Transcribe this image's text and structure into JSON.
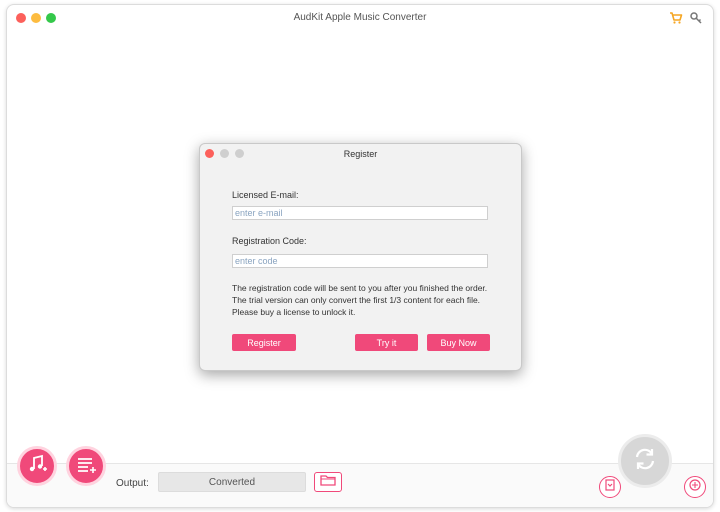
{
  "window": {
    "title": "AudKit Apple Music Converter"
  },
  "toolbar": {
    "cart_icon": "cart-icon",
    "key_icon": "key-icon"
  },
  "dialog": {
    "title": "Register",
    "email_label": "Licensed E-mail:",
    "email_placeholder": "enter e-mail",
    "email_value": "",
    "code_label": "Registration Code:",
    "code_placeholder": "enter code",
    "code_value": "",
    "note": "The registration code will be sent to you after you finished the order. The trial version can only convert the first 1/3 content for each file. Please buy a license to unlock it.",
    "register_button": "Register",
    "try_button": "Try it",
    "buy_button": "Buy Now"
  },
  "footer": {
    "output_label": "Output:",
    "output_value": "Converted",
    "add_music_icon": "add-music-icon",
    "playlist_icon": "playlist-icon",
    "folder_icon": "folder-icon",
    "convert_icon": "convert-icon",
    "history_icon": "history-icon",
    "format_icon": "format-icon"
  },
  "colors": {
    "accent": "#f0497a",
    "close": "#fc605b",
    "minimize": "#fdbc40",
    "maximize": "#34c84a"
  }
}
